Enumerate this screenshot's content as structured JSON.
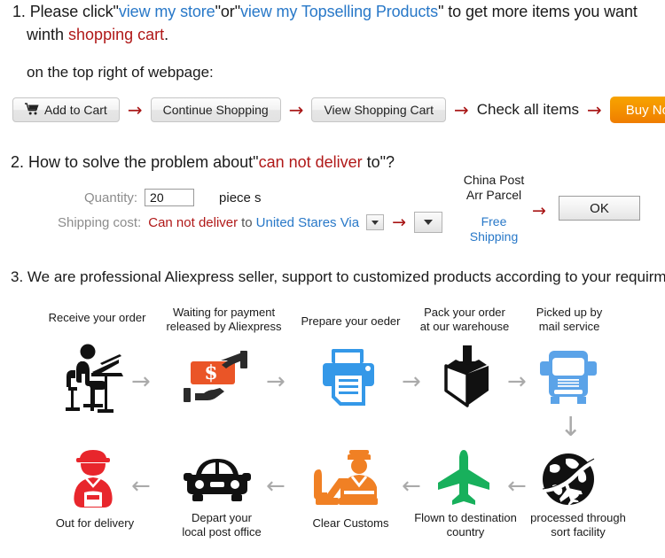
{
  "section1": {
    "number": "1.",
    "line1_a": "Please click\"",
    "line1_link1": "view my store",
    "line1_b": "\"or\"",
    "line1_link2": "view my Topselling Products",
    "line1_c": "\" to get more items you want",
    "line2_a": "winth ",
    "line2_red": "shopping cart",
    "line2_b": ".",
    "subtitle": "on the top right of webpage:",
    "buttons": {
      "add_to_cart": "Add to Cart",
      "continue_shopping": "Continue Shopping",
      "view_shopping_cart": "View Shopping Cart",
      "check_all_items": "Check all items",
      "buy_now": "Buy Now"
    },
    "arrow": "→"
  },
  "section2": {
    "number": "2.",
    "head_a": "How to solve the problem about\"",
    "head_red": "can not deliver",
    "head_b": " to\"?",
    "quantity_label": "Quantity:",
    "quantity_value": "20",
    "pieces_label": "piece s",
    "shipping_label": "Shipping cost:",
    "shipping_red": "Can not deliver",
    "shipping_to": "to",
    "shipping_blue": "United Stares Via",
    "dropdown_glyph": "▼",
    "arrow": "→",
    "post_line1": "China Post",
    "post_line2": "Arr Parcel",
    "free_line1": "Free",
    "free_line2": "Shipping",
    "ok_label": "OK"
  },
  "section3": {
    "number": "3.",
    "heading": "We are professional Aliexpress seller, support to customized products according to your requirment.",
    "arrow_right": "→",
    "arrow_left": "←",
    "arrow_down": "↓",
    "steps_top": [
      {
        "label_line1": "Receive your order",
        "label_line2": "",
        "icon": "person-at-desk-icon"
      },
      {
        "label_line1": "Waiting for payment",
        "label_line2": "released by Aliexpress",
        "icon": "money-in-hand-icon"
      },
      {
        "label_line1": "Prepare your oeder",
        "label_line2": "",
        "icon": "printer-icon"
      },
      {
        "label_line1": "Pack your order",
        "label_line2": "at our warehouse",
        "icon": "open-box-icon"
      },
      {
        "label_line1": "Picked up by",
        "label_line2": "mail service",
        "icon": "truck-icon"
      }
    ],
    "steps_bottom": [
      {
        "label_line1": "Out for delivery",
        "label_line2": "",
        "icon": "delivery-person-icon"
      },
      {
        "label_line1": "Depart your",
        "label_line2": "local post office",
        "icon": "car-icon"
      },
      {
        "label_line1": "Clear Customs",
        "label_line2": "",
        "icon": "customs-officer-icon"
      },
      {
        "label_line1": "Flown to destination",
        "label_line2": "country",
        "icon": "airplane-icon"
      },
      {
        "label_line1": "processed through",
        "label_line2": "sort facility",
        "icon": "globe-plane-icon"
      }
    ]
  },
  "colors": {
    "link_blue": "#2878c8",
    "alert_red": "#b01818",
    "arrow_red": "#a81414",
    "buy_now_orange": "#f49200",
    "icon_blue": "#5ba3e8",
    "icon_orange": "#ea5527",
    "icon_green": "#18b05c",
    "icon_red": "#e8262c",
    "flow_arrow_gray": "#aaaaaa"
  }
}
